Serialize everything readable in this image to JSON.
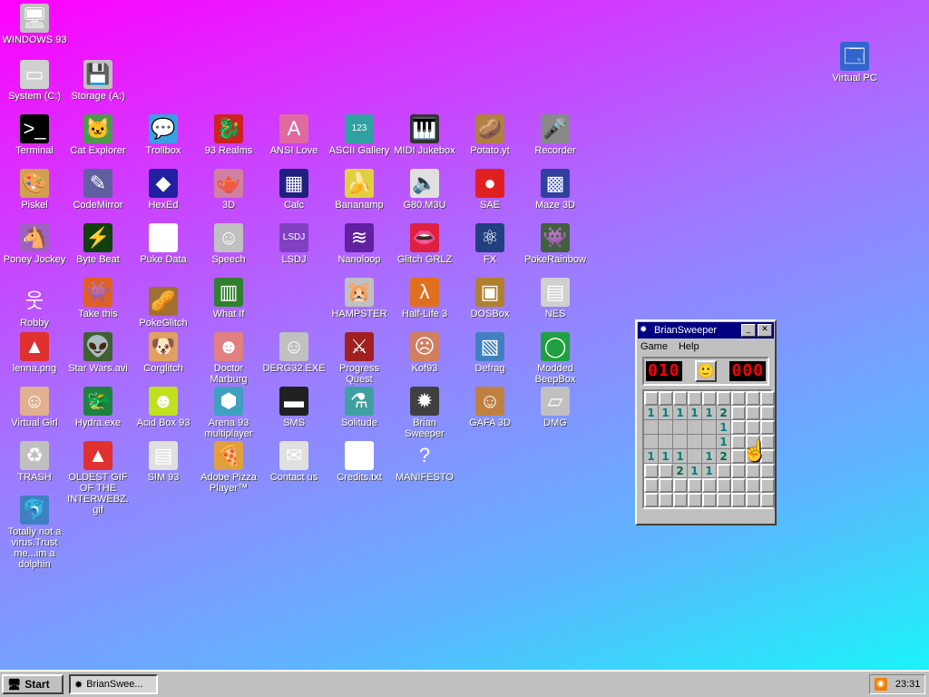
{
  "desktop": {
    "icons": [
      {
        "label": "WINDOWS 93",
        "glyph": "🖥",
        "bg": "#c0c0c0"
      },
      {
        "label": "System (C:)",
        "glyph": "▭",
        "bg": "#d0d0d0"
      },
      {
        "label": "Storage (A:)",
        "glyph": "💾",
        "bg": "#c0c0c0"
      },
      {
        "label": "Virtual PC",
        "glyph": "🗔",
        "bg": "#3366cc"
      },
      {
        "label": "Terminal",
        "glyph": ">_",
        "bg": "#000000"
      },
      {
        "label": "Cat Explorer",
        "glyph": "🐱",
        "bg": "#4a9a4a"
      },
      {
        "label": "Trollbox",
        "glyph": "💬",
        "bg": "#3aa0e0"
      },
      {
        "label": "93 Realms",
        "glyph": "🐉",
        "bg": "#cc2222"
      },
      {
        "label": "ANSI Love",
        "glyph": "A",
        "bg": "#e06aa0"
      },
      {
        "label": "ASCII Gallery",
        "glyph": "123",
        "bg": "#30a0a0"
      },
      {
        "label": "MIDI Jukebox",
        "glyph": "🎹",
        "bg": "#333333"
      },
      {
        "label": "Potato.yt",
        "glyph": "🥔",
        "bg": "#b08040"
      },
      {
        "label": "Recorder",
        "glyph": "🎤",
        "bg": "#888888"
      },
      {
        "label": "Piskel",
        "glyph": "🎨",
        "bg": "#d0a050"
      },
      {
        "label": "CodeMirror",
        "glyph": "✎",
        "bg": "#6060a0"
      },
      {
        "label": "HexEd",
        "glyph": "◆",
        "bg": "#2020a0"
      },
      {
        "label": "3D",
        "glyph": "🫖",
        "bg": "#d080a0"
      },
      {
        "label": "Calc",
        "glyph": "▦",
        "bg": "#202080"
      },
      {
        "label": "Bananamp",
        "glyph": "🍌",
        "bg": "#e0d040"
      },
      {
        "label": "G80.M3U",
        "glyph": "🔈",
        "bg": "#e0e0e0"
      },
      {
        "label": "SAE",
        "glyph": "●",
        "bg": "#e02020"
      },
      {
        "label": "Maze 3D",
        "glyph": "▩",
        "bg": "#3040a0"
      },
      {
        "label": "Poney Jockey",
        "glyph": "🐴",
        "bg": "#a060c0"
      },
      {
        "label": "Byte Beat",
        "glyph": "⚡",
        "bg": "#104010"
      },
      {
        "label": "Puke Data",
        "glyph": "Pd",
        "bg": "#ffffff"
      },
      {
        "label": "Speech",
        "glyph": "☺",
        "bg": "#c0c0c0"
      },
      {
        "label": "LSDJ",
        "glyph": "LSDJ",
        "bg": "#8040c0"
      },
      {
        "label": "Nanoloop",
        "glyph": "≋",
        "bg": "#6020a0"
      },
      {
        "label": "Glitch GRLZ",
        "glyph": "👄",
        "bg": "#e02040"
      },
      {
        "label": "FX",
        "glyph": "⚛",
        "bg": "#204080"
      },
      {
        "label": "PokeRainbow",
        "glyph": "👾",
        "bg": "#406040"
      },
      {
        "label": "Robby",
        "glyph": "웃",
        "bg": "transparent"
      },
      {
        "label": "Take this",
        "glyph": "👾",
        "bg": "#e06020"
      },
      {
        "label": "PokeGlitch",
        "glyph": "🥜",
        "bg": "#a07030"
      },
      {
        "label": "What If",
        "glyph": "▥",
        "bg": "#308030"
      },
      {
        "label": "HAMPSTER",
        "glyph": "🐹",
        "bg": "#c0c0c0"
      },
      {
        "label": "Half-Life 3",
        "glyph": "λ",
        "bg": "#e07020"
      },
      {
        "label": "DOSBox",
        "glyph": "▣",
        "bg": "#b08030"
      },
      {
        "label": "NES",
        "glyph": "▤",
        "bg": "#d0d0d0"
      },
      {
        "label": "lenna.png",
        "glyph": "▲",
        "bg": "#e03030"
      },
      {
        "label": "Star Wars.avi",
        "glyph": "👽",
        "bg": "#406030"
      },
      {
        "label": "Corglitch",
        "glyph": "🐶",
        "bg": "#e0a060"
      },
      {
        "label": "Doctor Marburg",
        "glyph": "☻",
        "bg": "#e08080"
      },
      {
        "label": "DERG32.EXE",
        "glyph": "☺",
        "bg": "#c0c0c0"
      },
      {
        "label": "Progress Quest",
        "glyph": "⚔",
        "bg": "#a02020"
      },
      {
        "label": "Kof93",
        "glyph": "☹",
        "bg": "#d08060"
      },
      {
        "label": "Defrag",
        "glyph": "▧",
        "bg": "#4080c0"
      },
      {
        "label": "Modded BeepBox",
        "glyph": "◯",
        "bg": "#20a040"
      },
      {
        "label": "Virtual Girl",
        "glyph": "☺",
        "bg": "#e0b090"
      },
      {
        "label": "Hydra.exe",
        "glyph": "🐲",
        "bg": "#208040"
      },
      {
        "label": "Acid Box 93",
        "glyph": "☻",
        "bg": "#c0e020"
      },
      {
        "label": "Arena 93 multiplayer",
        "glyph": "⬢",
        "bg": "#40a0c0"
      },
      {
        "label": "SMS",
        "glyph": "▬",
        "bg": "#202020"
      },
      {
        "label": "Solitude",
        "glyph": "⚗",
        "bg": "#40a0a0"
      },
      {
        "label": "Brian Sweeper",
        "glyph": "✹",
        "bg": "#404040"
      },
      {
        "label": "GAFA 3D",
        "glyph": "☺",
        "bg": "#c08040"
      },
      {
        "label": "DMG",
        "glyph": "▱",
        "bg": "#c0c0c0"
      },
      {
        "label": "TRASH",
        "glyph": "♻",
        "bg": "#c0c0c0"
      },
      {
        "label": "OLDEST GIF OF THE INTERWEBZ.gif",
        "glyph": "▲",
        "bg": "#e03030"
      },
      {
        "label": "SIM 93",
        "glyph": "▤",
        "bg": "#e0e0e0"
      },
      {
        "label": "Adobe Pizza Player™",
        "glyph": "🍕",
        "bg": "#e0a040"
      },
      {
        "label": "Contact us",
        "glyph": "✉",
        "bg": "#e0e0e0"
      },
      {
        "label": "Credits.txt",
        "glyph": "≡",
        "bg": "#ffffff"
      },
      {
        "label": "MANIFESTO",
        "glyph": "?",
        "bg": "transparent"
      },
      {
        "label": "Totally not a virus.Trust me...im a dolphin",
        "glyph": "🐬",
        "bg": "#4080c0"
      }
    ]
  },
  "window": {
    "title": "BrianSweeper",
    "menu": [
      "Game",
      "Help"
    ],
    "mines_left": "010",
    "timer": "000",
    "smiley": "🙂",
    "grid": [
      [
        "c",
        "c",
        "c",
        "c",
        "c",
        "c",
        "c",
        "c",
        "c"
      ],
      [
        "1",
        "1",
        "1",
        "1",
        "1",
        "2",
        "c",
        "c",
        "c"
      ],
      [
        "o",
        "o",
        "o",
        "o",
        "o",
        "1",
        "c",
        "c",
        "c"
      ],
      [
        "o",
        "o",
        "o",
        "o",
        "o",
        "1",
        "c",
        "c",
        "c"
      ],
      [
        "1",
        "1",
        "1",
        "o",
        "1",
        "2",
        "c",
        "c",
        "c"
      ],
      [
        "c",
        "c",
        "2",
        "1",
        "1",
        "c",
        "c",
        "c",
        "c"
      ],
      [
        "c",
        "c",
        "c",
        "c",
        "c",
        "c",
        "c",
        "c",
        "c"
      ],
      [
        "c",
        "c",
        "c",
        "c",
        "c",
        "c",
        "c",
        "c",
        "c"
      ]
    ]
  },
  "taskbar": {
    "start_label": "Start",
    "task_label": "BrianSwee...",
    "clock": "23:31"
  }
}
